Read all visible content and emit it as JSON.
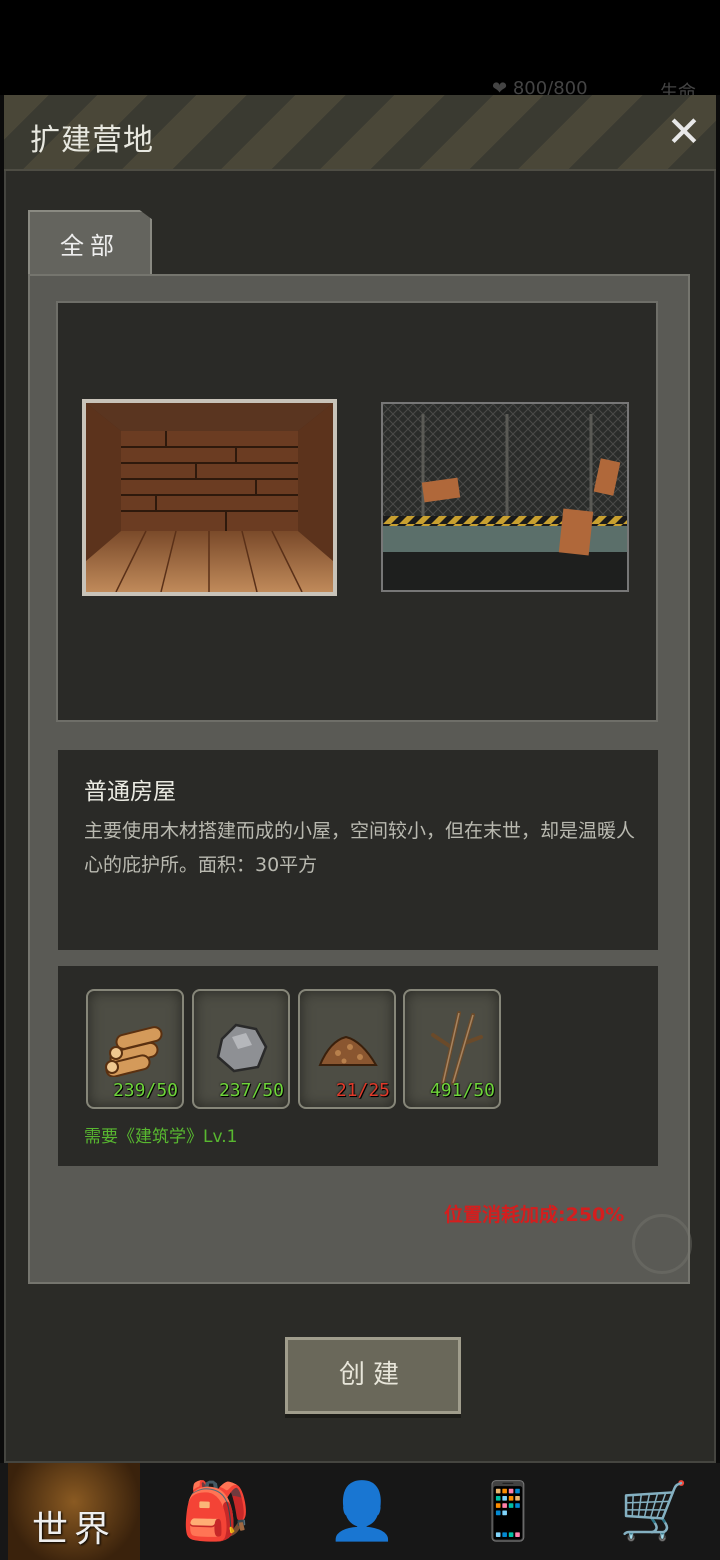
{
  "status": {
    "hp": "800/800",
    "life_label": "生命"
  },
  "dialog": {
    "title": "扩建营地",
    "close_glyph": "✕",
    "tab_label": "全部"
  },
  "building": {
    "name": "普通房屋",
    "description": "主要使用木材搭建而成的小屋，空间较小，但在末世，却是温暖人心的庇护所。面积：30平方"
  },
  "materials": [
    {
      "icon": "wood-logs-icon",
      "count": "239/50",
      "sufficient": true
    },
    {
      "icon": "stone-icon",
      "count": "237/50",
      "sufficient": true
    },
    {
      "icon": "dirt-pile-icon",
      "count": "21/25",
      "sufficient": false
    },
    {
      "icon": "branches-icon",
      "count": "491/50",
      "sufficient": true
    }
  ],
  "requirement": "需要《建筑学》Lv.1",
  "position_bonus": "位置消耗加成:250%",
  "create_label": "创建",
  "nav": {
    "world_label": "世界"
  },
  "colors": {
    "ok": "#6ed43a",
    "insufficient": "#e03a2a",
    "requirement": "#58b830",
    "bonus": "#d41e1e"
  }
}
